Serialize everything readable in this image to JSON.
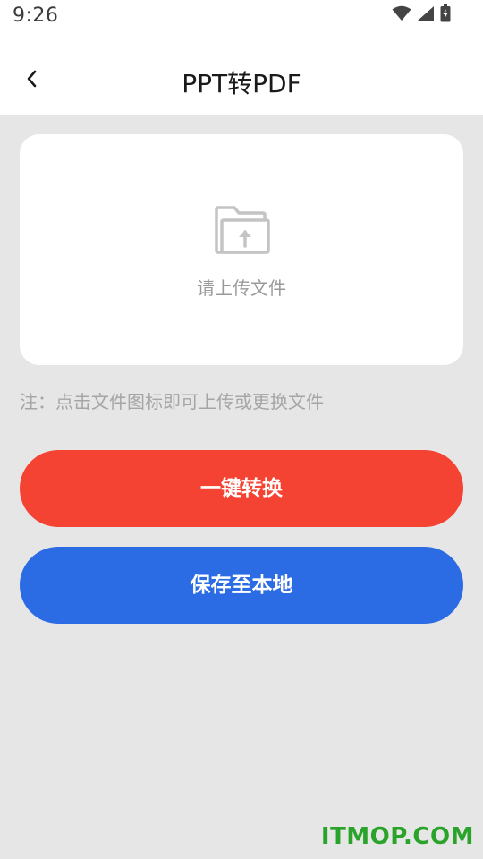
{
  "status_bar": {
    "time": "9:26",
    "icons": [
      "wifi-icon",
      "signal-icon",
      "battery-icon"
    ]
  },
  "header": {
    "back_icon": "chevron-left-icon",
    "title": "PPT转PDF"
  },
  "upload": {
    "icon": "folder-upload-icon",
    "label": "请上传文件"
  },
  "note": "注：点击文件图标即可上传或更换文件",
  "buttons": {
    "convert_label": "一键转换",
    "save_label": "保存至本地"
  },
  "watermark": "ITMOP.COM",
  "colors": {
    "background": "#e6e6e6",
    "convert_button": "#f54333",
    "save_button": "#2b6be4",
    "watermark": "#2aa32a"
  }
}
